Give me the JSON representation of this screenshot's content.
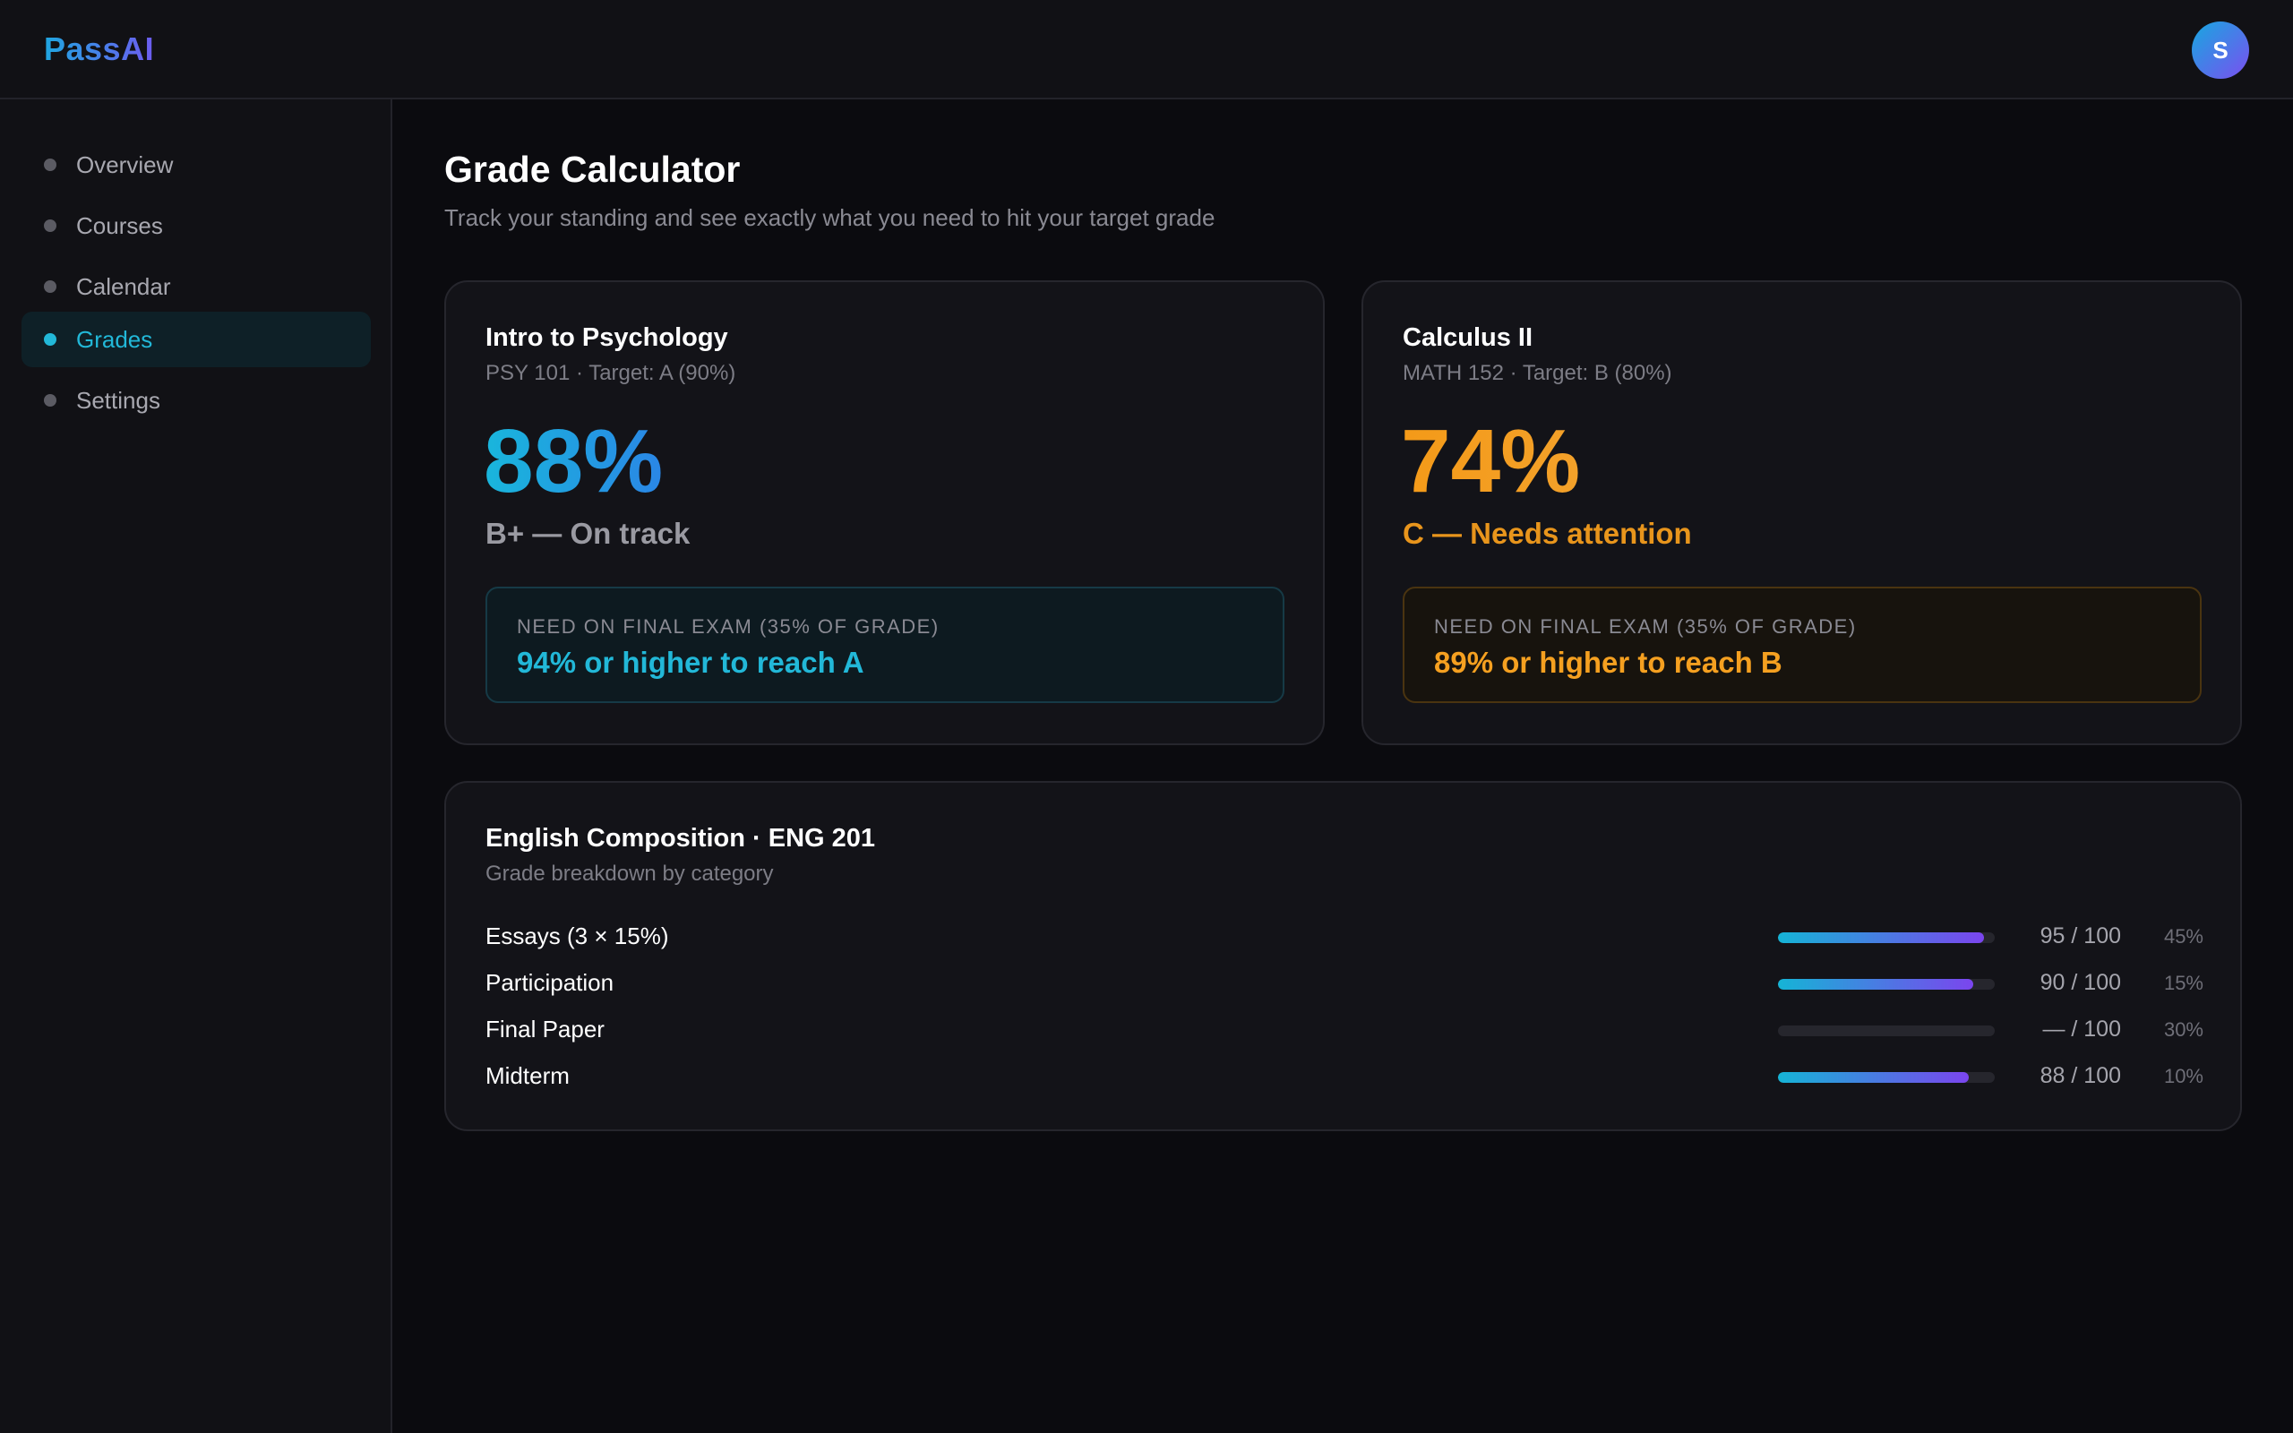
{
  "app": {
    "logo": "PassAI",
    "avatar_initial": "S"
  },
  "sidebar": {
    "items": [
      {
        "label": "Overview",
        "active": false
      },
      {
        "label": "Courses",
        "active": false
      },
      {
        "label": "Calendar",
        "active": false
      },
      {
        "label": "Grades",
        "active": true
      },
      {
        "label": "Settings",
        "active": false
      }
    ]
  },
  "main": {
    "title": "Grade Calculator",
    "subtitle": "Track your standing and see exactly what you need to hit your target grade"
  },
  "courses": [
    {
      "title": "Intro to Psychology",
      "meta": "PSY 101 · Target: A (90%)",
      "percent": "88%",
      "status": "B+ — On track",
      "need_label": "NEED ON FINAL EXAM (35% OF GRADE)",
      "need_value": "94% or higher to reach A",
      "accent": "#22b8d8"
    },
    {
      "title": "Calculus II",
      "meta": "MATH 152 · Target: B (80%)",
      "percent": "74%",
      "status": "C — Needs attention",
      "need_label": "NEED ON FINAL EXAM (35% OF GRADE)",
      "need_value": "89% or higher to reach B",
      "accent": "#f5a020"
    }
  ],
  "breakdown": {
    "title": "English Composition · ENG 201",
    "subtitle": "Grade breakdown by category",
    "rows": [
      {
        "name": "Essays (3 × 15%)",
        "score": "95 / 100",
        "weight": "45%",
        "progress": 0.95
      },
      {
        "name": "Participation",
        "score": "90 / 100",
        "weight": "15%",
        "progress": 0.9
      },
      {
        "name": "Final Paper",
        "score": "— / 100",
        "weight": "30%",
        "progress": 0
      },
      {
        "name": "Midterm",
        "score": "88 / 100",
        "weight": "10%",
        "progress": 0.88
      }
    ]
  },
  "colors": {
    "accent_cyan": "#22b8d8",
    "accent_orange": "#f5a020",
    "gradient_start": "#15b4d6",
    "gradient_end": "#7b45ee"
  },
  "icons": {
    "nav_bullet": "dot-icon"
  }
}
